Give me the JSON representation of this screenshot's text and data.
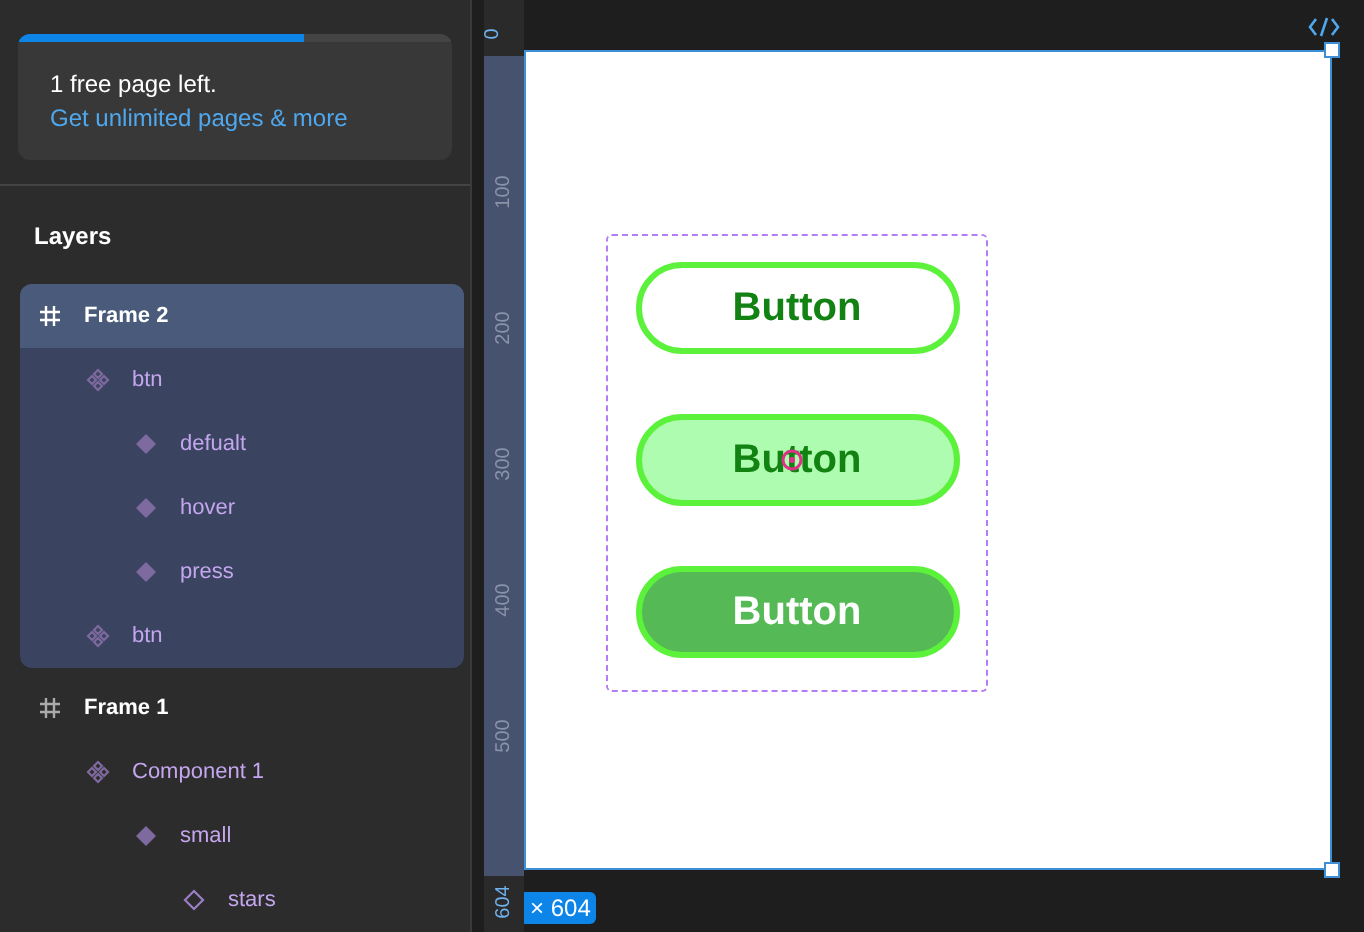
{
  "upgrade_card": {
    "level": 0.66,
    "message": "1 free page left.",
    "link": "Get unlimited pages & more"
  },
  "layers": {
    "title": "Layers",
    "items": [
      {
        "label": "Frame 2",
        "kind": "frame",
        "selected": true,
        "children": [
          {
            "label": "btn",
            "kind": "component",
            "selected": false,
            "children": [
              {
                "label": "defualt",
                "kind": "variant",
                "selected": false
              },
              {
                "label": "hover",
                "kind": "variant",
                "selected": false
              },
              {
                "label": "press",
                "kind": "variant",
                "selected": false
              }
            ]
          },
          {
            "label": "btn",
            "kind": "component",
            "selected": false
          }
        ]
      },
      {
        "label": "Frame 1",
        "kind": "frame",
        "selected": false,
        "children": [
          {
            "label": "Component 1",
            "kind": "component",
            "selected": false,
            "children": [
              {
                "label": "small",
                "kind": "variant",
                "selected": false,
                "children": [
                  {
                    "label": "stars",
                    "kind": "instance",
                    "selected": false
                  }
                ]
              }
            ]
          }
        ]
      }
    ]
  },
  "ruler": {
    "ticks": [
      "0",
      "100",
      "200",
      "300",
      "400",
      "500"
    ],
    "end_label": "604"
  },
  "size_badge": "× 604",
  "canvas": {
    "buttons": [
      {
        "label": "Button",
        "kind": "default"
      },
      {
        "label": "Button",
        "kind": "hover"
      },
      {
        "label": "Button",
        "kind": "press"
      }
    ]
  }
}
